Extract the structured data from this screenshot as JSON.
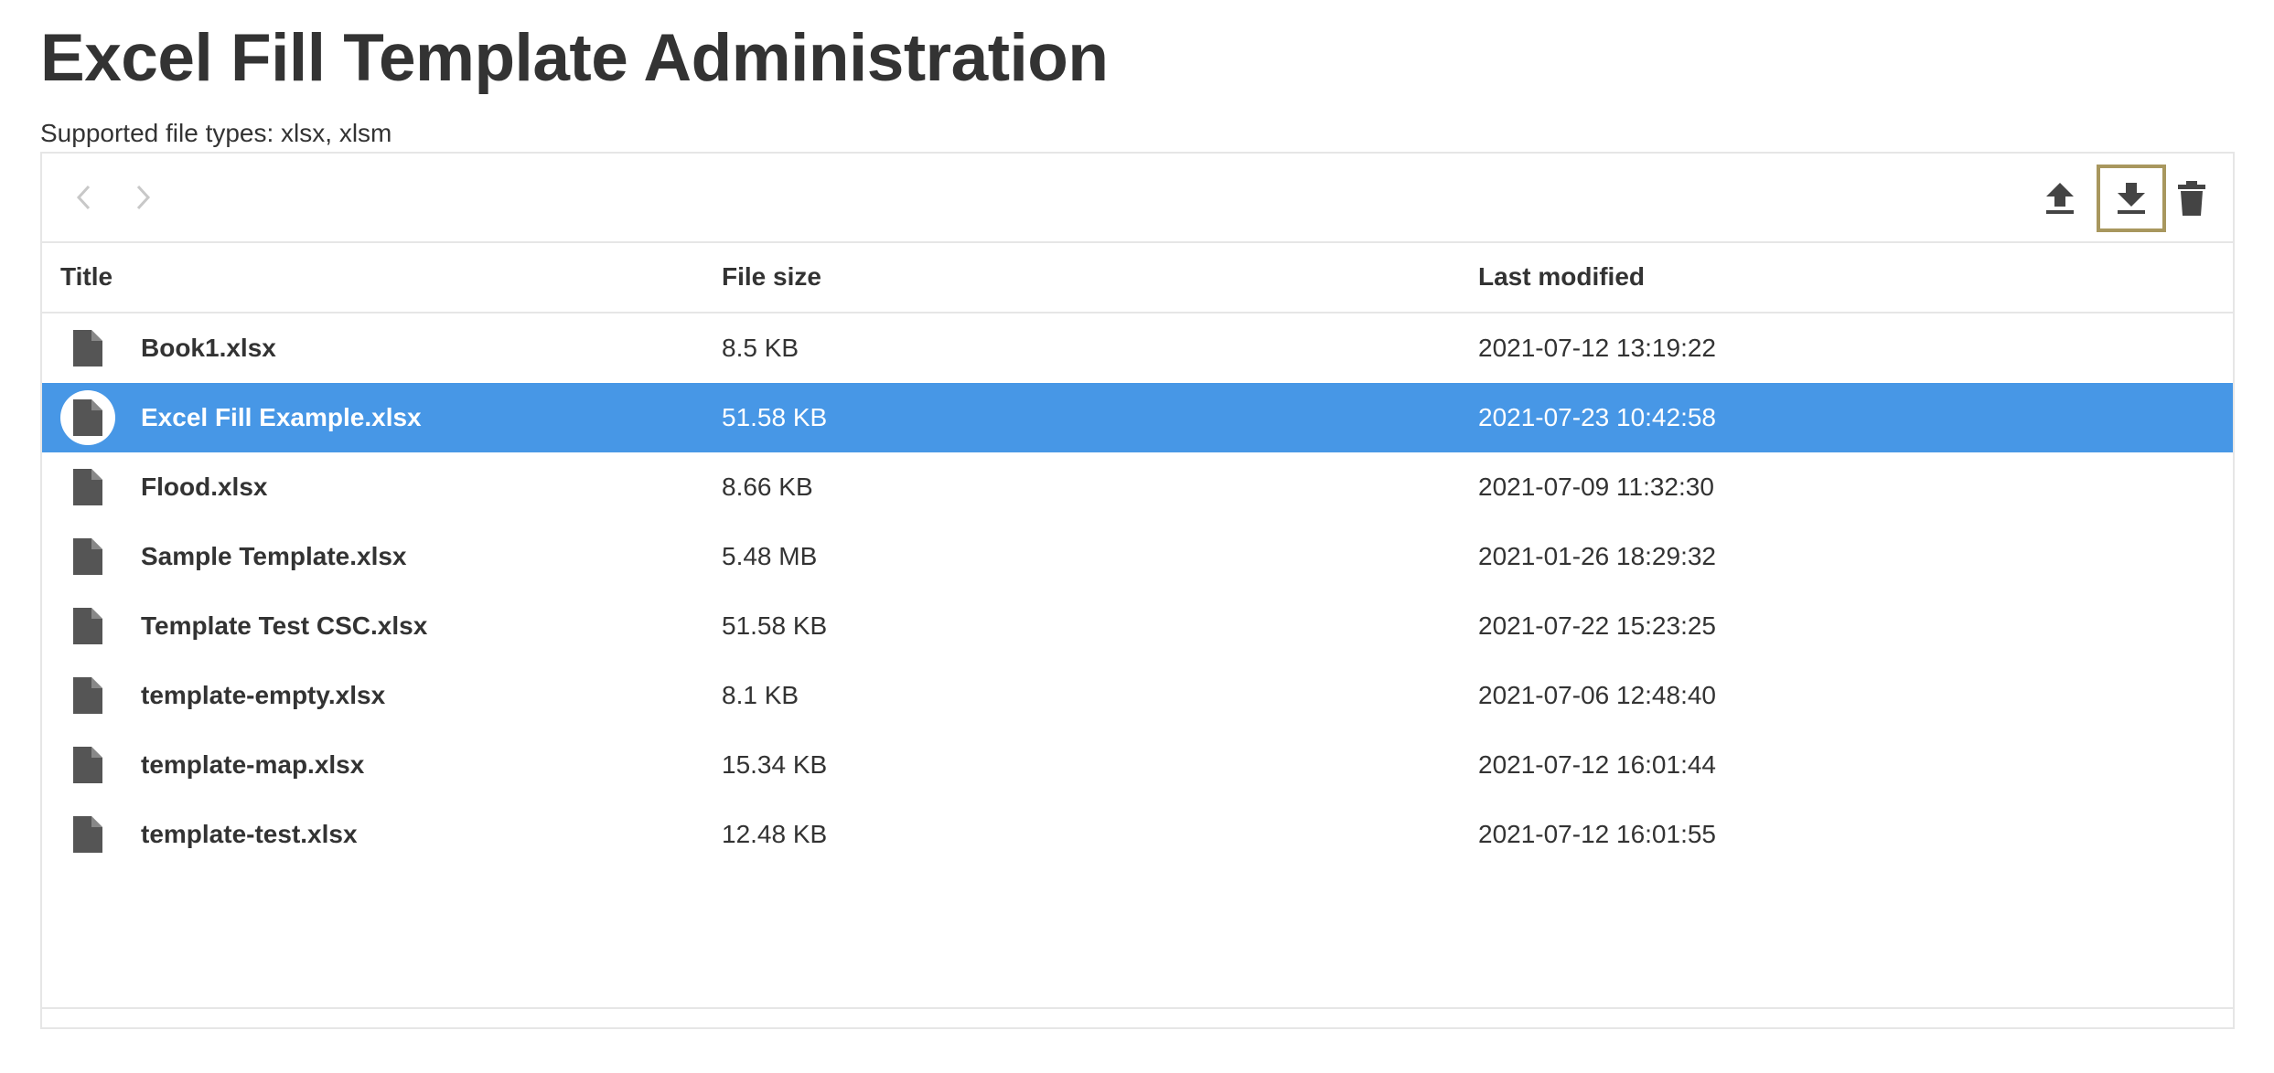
{
  "page": {
    "title": "Excel Fill Template Administration",
    "supported_types": "Supported file types: xlsx, xlsm"
  },
  "toolbar": {
    "back_icon": "chevron-left-icon",
    "forward_icon": "chevron-right-icon",
    "upload_icon": "upload-icon",
    "download_icon": "download-icon",
    "delete_icon": "trash-icon",
    "focused": "download"
  },
  "table": {
    "columns": [
      "Title",
      "File size",
      "Last modified"
    ],
    "rows": [
      {
        "name": "Book1.xlsx",
        "size": "8.5 KB",
        "modified": "2021-07-12 13:19:22",
        "selected": false
      },
      {
        "name": "Excel Fill Example.xlsx",
        "size": "51.58 KB",
        "modified": "2021-07-23 10:42:58",
        "selected": true
      },
      {
        "name": "Flood.xlsx",
        "size": "8.66 KB",
        "modified": "2021-07-09 11:32:30",
        "selected": false
      },
      {
        "name": "Sample Template.xlsx",
        "size": "5.48 MB",
        "modified": "2021-01-26 18:29:32",
        "selected": false
      },
      {
        "name": "Template Test CSC.xlsx",
        "size": "51.58 KB",
        "modified": "2021-07-22 15:23:25",
        "selected": false
      },
      {
        "name": "template-empty.xlsx",
        "size": "8.1 KB",
        "modified": "2021-07-06 12:48:40",
        "selected": false
      },
      {
        "name": "template-map.xlsx",
        "size": "15.34 KB",
        "modified": "2021-07-12 16:01:44",
        "selected": false
      },
      {
        "name": "template-test.xlsx",
        "size": "12.48 KB",
        "modified": "2021-07-12 16:01:55",
        "selected": false
      }
    ]
  },
  "colors": {
    "selected_row": "#4797e6",
    "focus_outline": "#a8975e",
    "icon": "#555555",
    "disabled_nav": "#c8c8c8"
  }
}
